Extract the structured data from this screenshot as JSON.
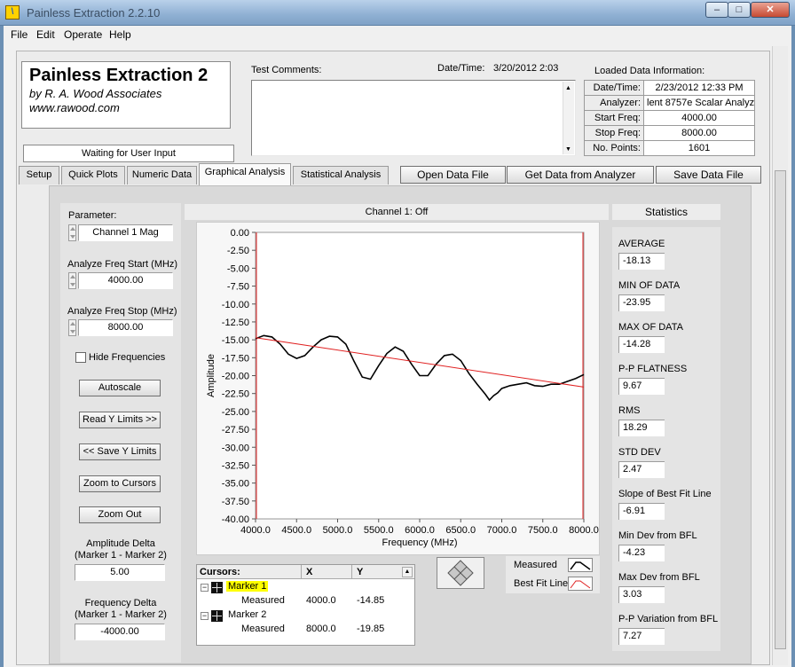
{
  "window": {
    "title": "Painless Extraction 2.2.10",
    "buttons": {
      "minimize": "–",
      "maximize": "□",
      "close": "✕"
    }
  },
  "menu": [
    {
      "label": "File"
    },
    {
      "label": "Edit"
    },
    {
      "label": "Operate"
    },
    {
      "label": "Help"
    }
  ],
  "header": {
    "product": "Painless Extraction 2",
    "company": "by R. A. Wood Associates",
    "website": "www.rawood.com",
    "status": "Waiting for User Input"
  },
  "comments": {
    "label": "Test Comments:",
    "datetime_label": "Date/Time:",
    "datetime": "3/20/2012  2:03"
  },
  "loaded_info": {
    "title": "Loaded Data Information:",
    "rows": [
      {
        "label": "Date/Time:",
        "value": "2/23/2012 12:33 PM"
      },
      {
        "label": "Analyzer:",
        "value": "lent 8757e Scalar Analyz"
      },
      {
        "label": "Start Freq:",
        "value": "4000.00"
      },
      {
        "label": "Stop Freq:",
        "value": "8000.00"
      },
      {
        "label": "No. Points:",
        "value": "1601"
      }
    ]
  },
  "tabs": [
    {
      "label": "Setup"
    },
    {
      "label": "Quick Plots"
    },
    {
      "label": "Numeric Data"
    },
    {
      "label": "Graphical Analysis"
    },
    {
      "label": "Statistical Analysis"
    }
  ],
  "file_buttons": {
    "open": "Open Data File",
    "get": "Get Data from Analyzer",
    "save": "Save Data File"
  },
  "controls": {
    "parameter_label": "Parameter:",
    "parameter_value": "Channel 1 Mag",
    "start_label": "Analyze Freq Start (MHz)",
    "start_value": "4000.00",
    "stop_label": "Analyze Freq Stop (MHz)",
    "stop_value": "8000.00",
    "hide_freq_label": "Hide Frequencies",
    "autoscale": "Autoscale",
    "read_y": "Read Y Limits >>",
    "save_y": "<< Save Y Limits",
    "zoom_cursors": "Zoom to Cursors",
    "zoom_out": "Zoom Out",
    "amp_delta_label1": "Amplitude Delta",
    "amp_delta_label2": "(Marker 1 - Marker 2)",
    "amp_delta_value": "5.00",
    "freq_delta_label1": "Frequency Delta",
    "freq_delta_label2": "(Marker 1 - Marker 2)",
    "freq_delta_value": "-4000.00"
  },
  "cursors": {
    "headers": [
      "Cursors:",
      "X",
      "Y"
    ],
    "rows": [
      {
        "name": "Marker 1",
        "sub": "Measured",
        "x": "4000.0",
        "y": "-14.85"
      },
      {
        "name": "Marker 2",
        "sub": "Measured",
        "x": "8000.0",
        "y": "-19.85"
      }
    ]
  },
  "legend": [
    {
      "name": "Measured",
      "color": "#000000"
    },
    {
      "name": "Best Fit Line",
      "color": "#e02020"
    }
  ],
  "statistics": {
    "title": "Statistics",
    "items": [
      {
        "label": "AVERAGE",
        "value": "-18.13"
      },
      {
        "label": "MIN OF DATA",
        "value": "-23.95"
      },
      {
        "label": "MAX OF DATA",
        "value": "-14.28"
      },
      {
        "label": "P-P FLATNESS",
        "value": "9.67"
      },
      {
        "label": "RMS",
        "value": "18.29"
      },
      {
        "label": "STD DEV",
        "value": "2.47"
      },
      {
        "label": "Slope of Best Fit Line",
        "value": "-6.91"
      },
      {
        "label": "Min Dev from BFL",
        "value": "-4.23"
      },
      {
        "label": "Max Dev from BFL",
        "value": "3.03"
      },
      {
        "label": "P-P Variation from BFL",
        "value": "7.27"
      }
    ]
  },
  "chart_data": {
    "type": "line",
    "title": "Channel 1: Off",
    "xlabel": "Frequency (MHz)",
    "ylabel": "Amplitude",
    "xlim": [
      4000,
      8000
    ],
    "ylim": [
      -40,
      0
    ],
    "xticks": [
      "4000.0",
      "4500.0",
      "5000.0",
      "5500.0",
      "6000.0",
      "6500.0",
      "7000.0",
      "7500.0",
      "8000.0"
    ],
    "yticks": [
      "0.00",
      "-2.50",
      "-5.00",
      "-7.50",
      "-10.00",
      "-12.50",
      "-15.00",
      "-17.50",
      "-20.00",
      "-22.50",
      "-25.00",
      "-27.50",
      "-30.00",
      "-32.50",
      "-35.00",
      "-37.50",
      "-40.00"
    ],
    "series": [
      {
        "name": "Measured",
        "color": "#000000",
        "x": [
          4000,
          4100,
          4200,
          4300,
          4400,
          4500,
          4600,
          4700,
          4800,
          4900,
          5000,
          5100,
          5200,
          5300,
          5400,
          5500,
          5600,
          5700,
          5800,
          5900,
          6000,
          6100,
          6200,
          6300,
          6400,
          6500,
          6600,
          6700,
          6800,
          6850,
          6900,
          6950,
          7000,
          7100,
          7200,
          7300,
          7400,
          7500,
          7600,
          7700,
          7800,
          7900,
          8000
        ],
        "y": [
          -14.85,
          -14.4,
          -14.6,
          -15.6,
          -17.0,
          -17.6,
          -17.2,
          -16.0,
          -15.0,
          -14.5,
          -14.6,
          -15.6,
          -18.0,
          -20.2,
          -20.5,
          -18.6,
          -16.9,
          -16.0,
          -16.6,
          -18.4,
          -20.0,
          -20.0,
          -18.4,
          -17.2,
          -17.0,
          -17.9,
          -19.7,
          -21.2,
          -22.6,
          -23.4,
          -22.8,
          -22.4,
          -21.8,
          -21.4,
          -21.2,
          -21.0,
          -21.4,
          -21.5,
          -21.2,
          -21.2,
          -20.8,
          -20.4,
          -19.85
        ]
      },
      {
        "name": "Best Fit Line",
        "color": "#e02020",
        "x": [
          4000,
          8000
        ],
        "y": [
          -14.7,
          -21.6
        ]
      }
    ]
  }
}
